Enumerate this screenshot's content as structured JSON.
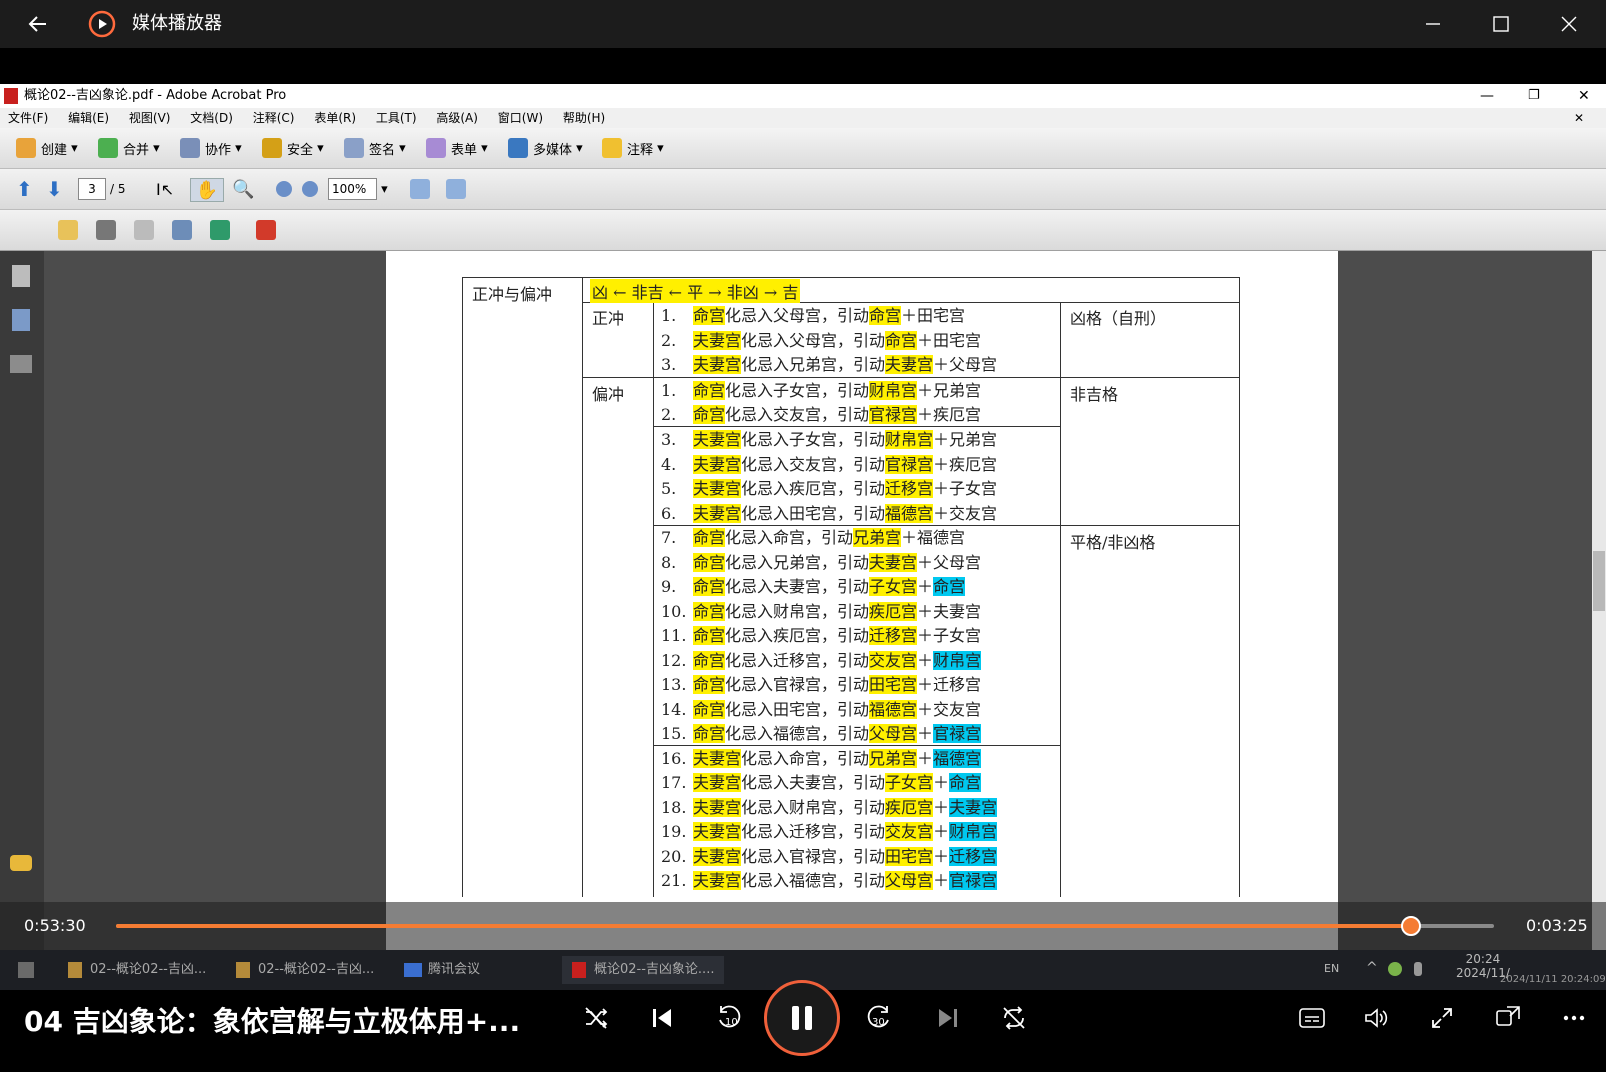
{
  "media_player": {
    "title": "媒体播放器",
    "video_title": "04 吉凶象论：象依宫解与立极体用+...",
    "elapsed": "0:53:30",
    "remaining": "0:03:25",
    "progress": 0.94,
    "accent": "#f57c33"
  },
  "acrobat": {
    "title": "概论02--吉凶象论.pdf - Adobe Acrobat Pro",
    "menu": [
      "文件(F)",
      "编辑(E)",
      "视图(V)",
      "文档(D)",
      "注释(C)",
      "表单(R)",
      "工具(T)",
      "高级(A)",
      "窗口(W)",
      "帮助(H)"
    ],
    "toolbar1": [
      "创建",
      "合并",
      "协作",
      "安全",
      "签名",
      "表单",
      "多媒体",
      "注释"
    ],
    "page_current": "3",
    "page_total": "/ 5",
    "zoom": "100%"
  },
  "table": {
    "header_left": "正冲与偏冲",
    "header_scale": "凶 ← 非吉 ← 平 → 非凶 → 吉",
    "group1_label": "正冲",
    "group2_label": "偏冲",
    "verdict1": "凶格（自刑）",
    "verdict2": "非吉格",
    "verdict3": "平格/非凶格",
    "rows": [
      {
        "n": "1.",
        "a": "命宫",
        "b": "化忌入父母宫，引动",
        "c": "命宫",
        "d": "＋田宅宫",
        "e": ""
      },
      {
        "n": "2.",
        "a": "夫妻宫",
        "b": "化忌入父母宫，引动",
        "c": "命宫",
        "d": "＋田宅宫",
        "e": ""
      },
      {
        "n": "3.",
        "a": "夫妻宫",
        "b": "化忌入兄弟宫，引动",
        "c": "夫妻宫",
        "d": "＋父母宫",
        "e": ""
      },
      {
        "n": "1.",
        "a": "命宫",
        "b": "化忌入子女宫，引动",
        "c": "财帛宫",
        "d": "＋兄弟宫",
        "e": ""
      },
      {
        "n": "2.",
        "a": "命宫",
        "b": "化忌入交友宫，引动",
        "c": "官禄宫",
        "d": "＋疾厄宫",
        "e": ""
      },
      {
        "n": "3.",
        "a": "夫妻宫",
        "b": "化忌入子女宫，引动",
        "c": "财帛宫",
        "d": "＋兄弟宫",
        "e": ""
      },
      {
        "n": "4.",
        "a": "夫妻宫",
        "b": "化忌入交友宫，引动",
        "c": "官禄宫",
        "d": "＋疾厄宫",
        "e": ""
      },
      {
        "n": "5.",
        "a": "夫妻宫",
        "b": "化忌入疾厄宫，引动",
        "c": "迁移宫",
        "d": "＋子女宫",
        "e": ""
      },
      {
        "n": "6.",
        "a": "夫妻宫",
        "b": "化忌入田宅宫，引动",
        "c": "福德宫",
        "d": "＋交友宫",
        "e": ""
      },
      {
        "n": "7.",
        "a": "命宫",
        "b": "化忌入命宫，引动",
        "c": "兄弟宫",
        "d": "＋福德宫",
        "e": ""
      },
      {
        "n": "8.",
        "a": "命宫",
        "b": "化忌入兄弟宫，引动",
        "c": "夫妻宫",
        "d": "＋父母宫",
        "e": ""
      },
      {
        "n": "9.",
        "a": "命宫",
        "b": "化忌入夫妻宫，引动",
        "c": "子女宫",
        "d": "＋",
        "e": "命宫"
      },
      {
        "n": "10.",
        "a": "命宫",
        "b": "化忌入财帛宫，引动",
        "c": "疾厄宫",
        "d": "＋夫妻宫",
        "e": ""
      },
      {
        "n": "11.",
        "a": "命宫",
        "b": "化忌入疾厄宫，引动",
        "c": "迁移宫",
        "d": "＋子女宫",
        "e": ""
      },
      {
        "n": "12.",
        "a": "命宫",
        "b": "化忌入迁移宫，引动",
        "c": "交友宫",
        "d": "＋",
        "e": "财帛宫"
      },
      {
        "n": "13.",
        "a": "命宫",
        "b": "化忌入官禄宫，引动",
        "c": "田宅宫",
        "d": "＋迁移宫",
        "e": ""
      },
      {
        "n": "14.",
        "a": "命宫",
        "b": "化忌入田宅宫，引动",
        "c": "福德宫",
        "d": "＋交友宫",
        "e": ""
      },
      {
        "n": "15.",
        "a": "命宫",
        "b": "化忌入福德宫，引动",
        "c": "父母宫",
        "d": "＋",
        "e": "官禄宫"
      },
      {
        "n": "16.",
        "a": "夫妻宫",
        "b": "化忌入命宫，引动",
        "c": "兄弟宫",
        "d": "＋",
        "e": "福德宫"
      },
      {
        "n": "17.",
        "a": "夫妻宫",
        "b": "化忌入夫妻宫，引动",
        "c": "子女宫",
        "d": "＋",
        "e": "命宫"
      },
      {
        "n": "18.",
        "a": "夫妻宫",
        "b": "化忌入财帛宫，引动",
        "c": "疾厄宫",
        "d": "＋",
        "e": "夫妻宫"
      },
      {
        "n": "19.",
        "a": "夫妻宫",
        "b": "化忌入迁移宫，引动",
        "c": "交友宫",
        "d": "＋",
        "e": "财帛宫"
      },
      {
        "n": "20.",
        "a": "夫妻宫",
        "b": "化忌入官禄宫，引动",
        "c": "田宅宫",
        "d": "＋",
        "e": "迁移宫"
      },
      {
        "n": "21.",
        "a": "夫妻宫",
        "b": "化忌入福德宫，引动",
        "c": "父母宫",
        "d": "＋",
        "e": "官禄宫"
      }
    ]
  },
  "taskbar": {
    "tasks": [
      "02--概论02--吉凶...",
      "02--概论02--吉凶...",
      "腾讯会议",
      "概论02--吉凶象论...."
    ],
    "lang": "EN",
    "time": "20:24",
    "date": "2024/11/",
    "overlay_stamp": "2024/11/11 20:24:09"
  }
}
